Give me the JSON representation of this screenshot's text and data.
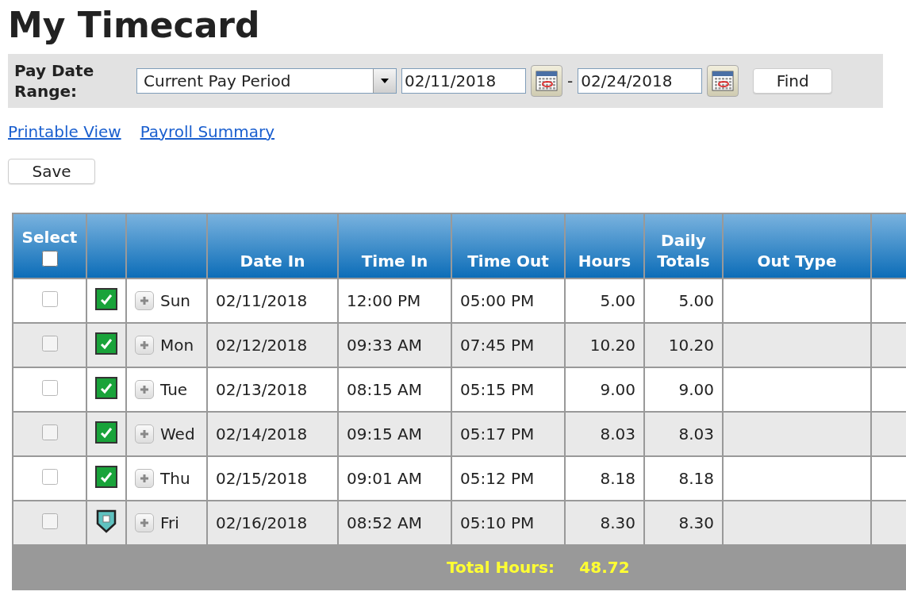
{
  "title": "My Timecard",
  "filter": {
    "label": "Pay Date Range:",
    "period": "Current Pay Period",
    "start_date": "02/11/2018",
    "separator": "-",
    "end_date": "02/24/2018",
    "find_button": "Find"
  },
  "links": [
    "Printable View",
    "Payroll Summary"
  ],
  "save_button": "Save",
  "table": {
    "select_all": {
      "label": "Select",
      "checked": false
    },
    "columns": [
      "Date In",
      "Time In",
      "Time Out",
      "Hours",
      "Daily Totals",
      "Out Type"
    ],
    "rows": [
      {
        "checked": false,
        "status": {
          "kind": "approved"
        },
        "day": "Sun",
        "date_in": "02/11/2018",
        "time_in": "12:00 PM",
        "time_out": "05:00 PM",
        "hours": "5.00",
        "daily_total": "5.00"
      },
      {
        "checked": false,
        "status": {
          "kind": "approved"
        },
        "day": "Mon",
        "date_in": "02/12/2018",
        "time_in": "09:33 AM",
        "time_out": "07:45 PM",
        "hours": "10.20",
        "daily_total": "10.20"
      },
      {
        "checked": false,
        "status": {
          "kind": "approved"
        },
        "day": "Tue",
        "date_in": "02/13/2018",
        "time_in": "08:15 AM",
        "time_out": "05:15 PM",
        "hours": "9.00",
        "daily_total": "9.00"
      },
      {
        "checked": false,
        "status": {
          "kind": "approved"
        },
        "day": "Wed",
        "date_in": "02/14/2018",
        "time_in": "09:15 AM",
        "time_out": "05:17 PM",
        "hours": "8.03",
        "daily_total": "8.03"
      },
      {
        "checked": false,
        "status": {
          "kind": "approved"
        },
        "day": "Thu",
        "date_in": "02/15/2018",
        "time_in": "09:01 AM",
        "time_out": "05:12 PM",
        "hours": "8.18",
        "daily_total": "8.18"
      },
      {
        "checked": false,
        "status": {
          "kind": "pending"
        },
        "day": "Fri",
        "date_in": "02/16/2018",
        "time_in": "08:52 AM",
        "time_out": "05:10 PM",
        "hours": "8.30",
        "daily_total": "8.30"
      }
    ],
    "total": {
      "label": "Total Hours:",
      "value": "48.72"
    }
  }
}
